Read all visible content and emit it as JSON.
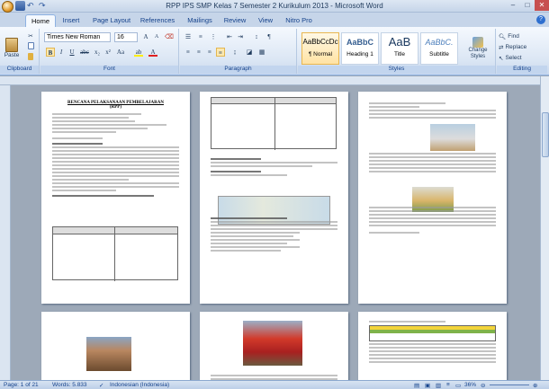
{
  "window": {
    "title": "RPP IPS SMP Kelas 7 Semester 2 Kurikulum 2013 - Microsoft Word"
  },
  "tabs": [
    {
      "label": "Home",
      "active": true
    },
    {
      "label": "Insert"
    },
    {
      "label": "Page Layout"
    },
    {
      "label": "References"
    },
    {
      "label": "Mailings"
    },
    {
      "label": "Review"
    },
    {
      "label": "View"
    },
    {
      "label": "Nitro Pro"
    }
  ],
  "ribbon": {
    "clipboard": {
      "label": "Clipboard",
      "paste": "Paste"
    },
    "font": {
      "label": "Font",
      "name": "Times New Roman",
      "size": "16"
    },
    "paragraph": {
      "label": "Paragraph"
    },
    "styles": {
      "label": "Styles",
      "items": [
        {
          "preview": "AaBbCcDc",
          "name": "¶ Normal"
        },
        {
          "preview": "AaBbC",
          "name": "Heading 1"
        },
        {
          "preview": "AaB",
          "name": "Title"
        },
        {
          "preview": "AaBbC.",
          "name": "Subtitle"
        }
      ],
      "change_styles": "Change Styles"
    },
    "editing": {
      "label": "Editing",
      "find": "Find",
      "replace": "Replace",
      "select": "Select"
    }
  },
  "document": {
    "page1_title": "RENCANA PELAKSANAAN PEMBELAJARAN",
    "page1_subtitle": "(RPP)"
  },
  "status": {
    "page": "Page: 1 of 21",
    "words": "Words: 5.833",
    "language": "Indonesian (Indonesia)",
    "zoom": "36%"
  }
}
